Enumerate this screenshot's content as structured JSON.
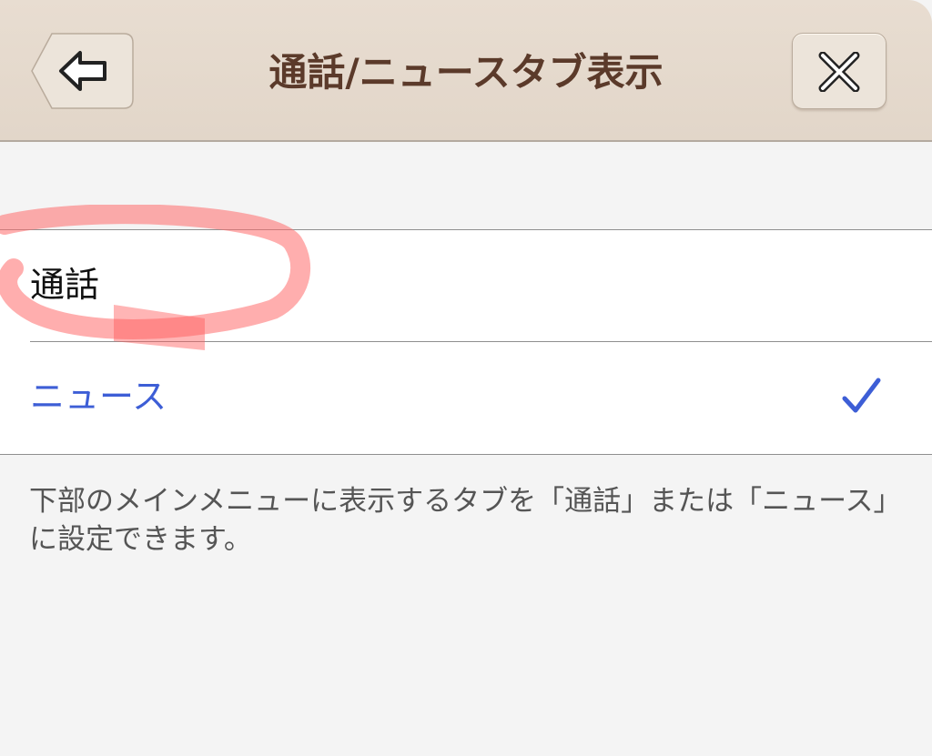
{
  "header": {
    "title": "通話/ニュースタブ表示",
    "back_icon": "back-arrow-icon",
    "close_icon": "close-icon"
  },
  "options": [
    {
      "label": "通話",
      "selected": false
    },
    {
      "label": "ニュース",
      "selected": true
    }
  ],
  "footer": {
    "description": "下部のメインメニューに表示するタブを「通話」または「ニュース」に設定できます。"
  },
  "colors": {
    "header_background": "#e6dbcf",
    "title_text": "#5b3a2a",
    "selected_text": "#3d5ed6",
    "checkmark": "#3d5ed6",
    "highlight_marker": "#ff6b6b",
    "page_background": "#f4f4f4"
  }
}
